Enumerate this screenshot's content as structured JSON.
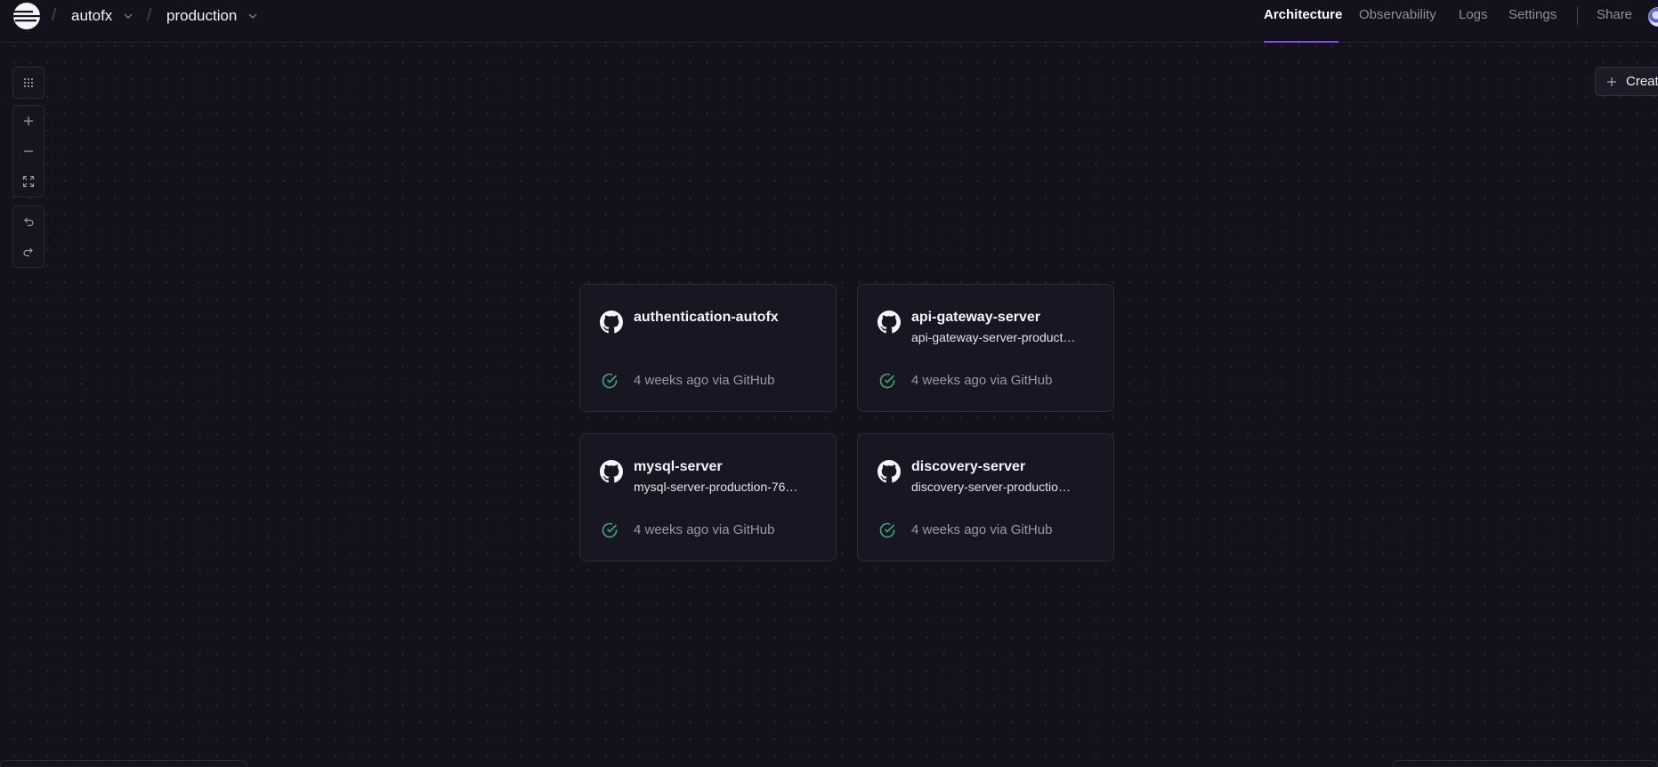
{
  "breadcrumb": {
    "project": "autofx",
    "environment": "production",
    "separator": "/"
  },
  "nav": {
    "tabs": [
      {
        "label": "Architecture",
        "active": true
      },
      {
        "label": "Observability",
        "active": false
      },
      {
        "label": "Logs",
        "active": false
      },
      {
        "label": "Settings",
        "active": false
      }
    ],
    "share_label": "Share"
  },
  "canvas_controls": {
    "icons": [
      "grid-icon",
      "zoom-in-icon",
      "zoom-out-icon",
      "fit-view-icon",
      "undo-icon",
      "redo-icon"
    ]
  },
  "create_button": {
    "label": "Create"
  },
  "services": [
    {
      "name": "authentication-autofx",
      "domain": "",
      "status": "4 weeks ago via GitHub"
    },
    {
      "name": "api-gateway-server",
      "domain": "api-gateway-server-product…",
      "status": "4 weeks ago via GitHub"
    },
    {
      "name": "mysql-server",
      "domain": "mysql-server-production-76…",
      "status": "4 weeks ago via GitHub"
    },
    {
      "name": "discovery-server",
      "domain": "discovery-server-productio…",
      "status": "4 weeks ago via GitHub"
    }
  ],
  "colors": {
    "background": "#13111c",
    "accent": "#7b4fe0",
    "success": "#3fa878",
    "card": "#181622"
  }
}
